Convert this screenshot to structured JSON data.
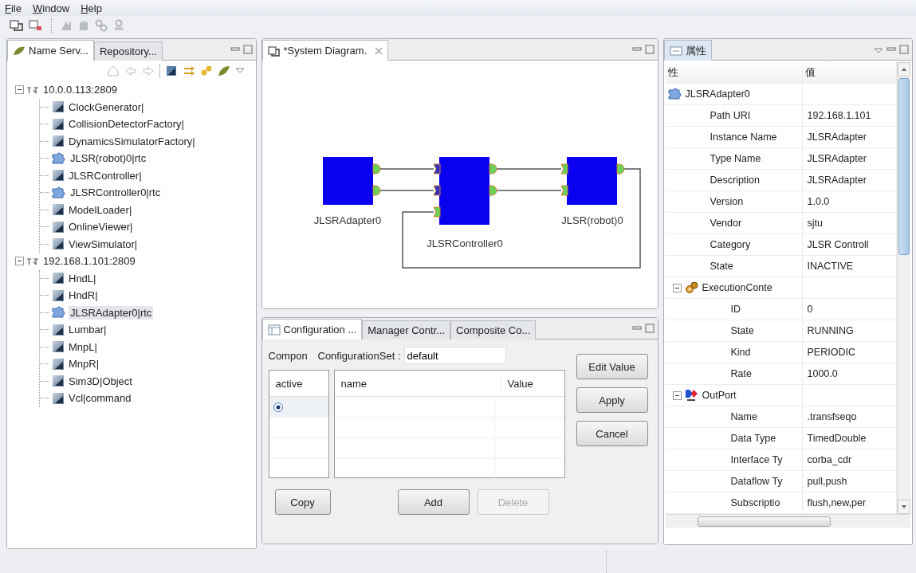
{
  "menu": [
    "File",
    "Window",
    "Help"
  ],
  "left_panel": {
    "tabs": [
      {
        "label": "Name Serv...",
        "selected": true
      },
      {
        "label": "Repository...",
        "selected": false
      }
    ],
    "tree": [
      {
        "label": "10.0.0.113:2809",
        "expanded": true,
        "children": [
          {
            "label": "ClockGenerator|",
            "kind": "component",
            "selected": false
          },
          {
            "label": "CollisionDetectorFactory|",
            "kind": "component",
            "selected": false
          },
          {
            "label": "DynamicsSimulatorFactory|",
            "kind": "component",
            "selected": false
          },
          {
            "label": "JLSR(robot)0|rtc",
            "kind": "rtc",
            "selected": false
          },
          {
            "label": "JLSRController|",
            "kind": "component",
            "selected": false
          },
          {
            "label": "JLSRController0|rtc",
            "kind": "rtc",
            "selected": false
          },
          {
            "label": "ModelLoader|",
            "kind": "component",
            "selected": false
          },
          {
            "label": "OnlineViewer|",
            "kind": "component",
            "selected": false
          },
          {
            "label": "ViewSimulator|",
            "kind": "component",
            "selected": false
          }
        ]
      },
      {
        "label": "192.168.1.101:2809",
        "expanded": true,
        "children": [
          {
            "label": "HndL|",
            "kind": "component",
            "selected": false
          },
          {
            "label": "HndR|",
            "kind": "component",
            "selected": false
          },
          {
            "label": "JLSRAdapter0|rtc",
            "kind": "rtc",
            "selected": true
          },
          {
            "label": "Lumbar|",
            "kind": "component",
            "selected": false
          },
          {
            "label": "MnpL|",
            "kind": "component",
            "selected": false
          },
          {
            "label": "MnpR|",
            "kind": "component",
            "selected": false
          },
          {
            "label": "Sim3D|Object",
            "kind": "component",
            "selected": false
          },
          {
            "label": "Vcl|command",
            "kind": "component",
            "selected": false
          }
        ]
      }
    ]
  },
  "diagram": {
    "tab": "*System Diagram.",
    "components": [
      {
        "name": "JLSRAdapter0"
      },
      {
        "name": "JLSRController0"
      },
      {
        "name": "JLSR(robot)0"
      }
    ]
  },
  "config_panel": {
    "tabs": [
      {
        "label": "Configuration ...",
        "selected": true
      },
      {
        "label": "Manager Contr...",
        "selected": false
      },
      {
        "label": "Composite Co...",
        "selected": false
      }
    ],
    "component_label": "Compon",
    "configset_label": "ConfigurationSet :",
    "configset_value": "default",
    "sets_table": {
      "columns": [
        "active"
      ],
      "rows": [
        {
          "selected": true
        }
      ]
    },
    "params_table": {
      "columns": [
        "name",
        "Value"
      ]
    },
    "side_buttons": [
      {
        "label": "Edit Value",
        "disabled": false
      },
      {
        "label": "Apply",
        "disabled": false
      },
      {
        "label": "Cancel",
        "disabled": false
      }
    ],
    "bottom_buttons": [
      {
        "label": "Copy",
        "disabled": false
      },
      {
        "label": "Add",
        "disabled": false
      },
      {
        "label": "Delete",
        "disabled": true
      }
    ]
  },
  "properties": {
    "tab": {
      "label": "属性",
      "selected": true
    },
    "columns": [
      "性",
      "值"
    ],
    "groups": [
      {
        "label": "JLSRAdapter0",
        "kind": "rtc",
        "rows": [
          {
            "name": "Path URI",
            "value": "192.168.1.101"
          },
          {
            "name": "Instance Name",
            "value": "JLSRAdapter"
          },
          {
            "name": "Type Name",
            "value": "JLSRAdapter"
          },
          {
            "name": "Description",
            "value": "JLSRAdapter"
          },
          {
            "name": "Version",
            "value": "1.0.0"
          },
          {
            "name": "Vendor",
            "value": "sjtu"
          },
          {
            "name": "Category",
            "value": "JLSR Controll"
          },
          {
            "name": "State",
            "value": "INACTIVE"
          }
        ]
      },
      {
        "label": "ExecutionConte",
        "kind": "context",
        "expanded": true,
        "rows": [
          {
            "name": "ID",
            "value": "0"
          },
          {
            "name": "State",
            "value": "RUNNING"
          },
          {
            "name": "Kind",
            "value": "PERIODIC"
          },
          {
            "name": "Rate",
            "value": "1000.0"
          }
        ]
      },
      {
        "label": "OutPort",
        "kind": "port",
        "expanded": true,
        "rows": [
          {
            "name": "Name",
            "value": ".transfseqo"
          },
          {
            "name": "Data Type",
            "value": "TimedDouble"
          },
          {
            "name": "Interface Ty",
            "value": "corba_cdr"
          },
          {
            "name": "Dataflow Ty",
            "value": "pull,push"
          },
          {
            "name": "Subscriptio",
            "value": "flush,new,per"
          }
        ]
      }
    ]
  }
}
